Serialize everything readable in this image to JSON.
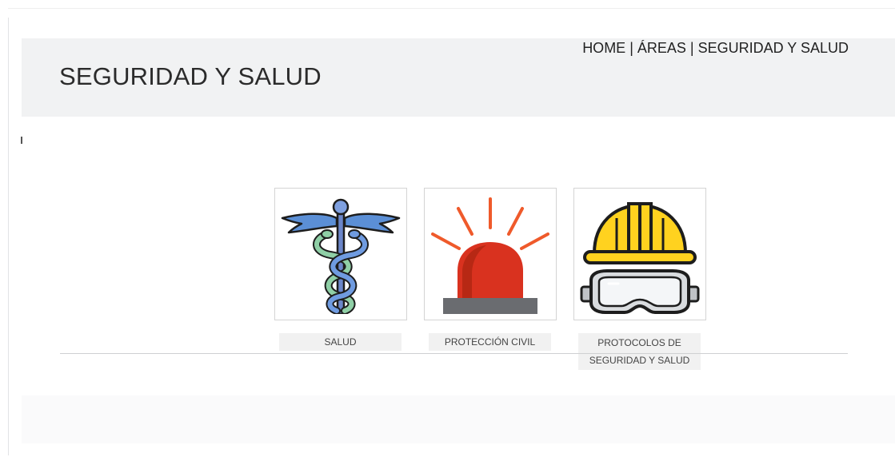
{
  "header": {
    "title": "SEGURIDAD Y SALUD",
    "breadcrumb": {
      "home": "HOME",
      "separator": " | ",
      "areas": "ÁREAS",
      "current": "SEGURIDAD Y SALUD"
    }
  },
  "cards": [
    {
      "label": "SALUD",
      "icon": "caduceus-icon"
    },
    {
      "label": "PROTECCIÓN CIVIL",
      "icon": "siren-icon"
    },
    {
      "label": "PROTOCOLOS DE SEGURIDAD Y SALUD",
      "icon": "hardhat-goggles-icon"
    }
  ],
  "colors": {
    "header_bg": "#f1f2f3",
    "label_bg": "#f1f1f1",
    "caduceus_blue": "#5b8fd6",
    "caduceus_green": "#8fcfa6",
    "siren_red": "#d9321f",
    "hardhat_yellow": "#ffd21f"
  }
}
